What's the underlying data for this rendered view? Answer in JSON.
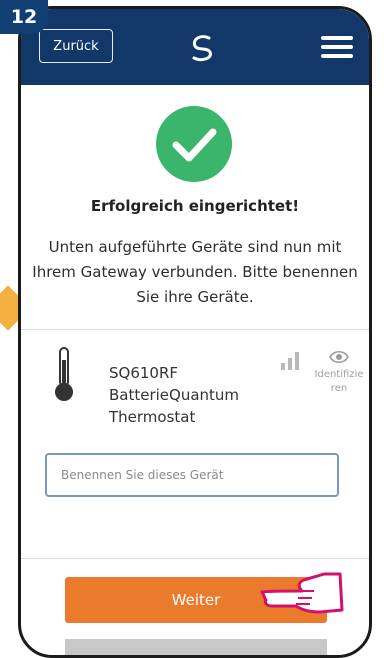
{
  "step_badge": "12",
  "header": {
    "back_label": "Zurück"
  },
  "main": {
    "title": "Erfolgreich eingerichtet!",
    "message": "Unten aufgeführte Geräte sind nun mit Ihrem Gateway verbunden. Bitte benennen Sie ihre Geräte."
  },
  "device": {
    "model": "SQ610RF",
    "name_line2": "BatterieQuantum",
    "name_line3": "Thermostat",
    "identify_label": "Identifizieren",
    "name_placeholder": "Benennen Sie dieses Gerät"
  },
  "actions": {
    "next_label": "Weiter"
  },
  "colors": {
    "header": "#12386a",
    "success": "#3bb56b",
    "accent": "#ec7a2c",
    "badge": "#123f73",
    "arrow": "#f3b23f"
  },
  "icons": [
    "logo-icon",
    "menu-icon",
    "success-check-icon",
    "thermometer-icon",
    "signal-icon",
    "eye-icon",
    "pointing-hand-icon"
  ]
}
